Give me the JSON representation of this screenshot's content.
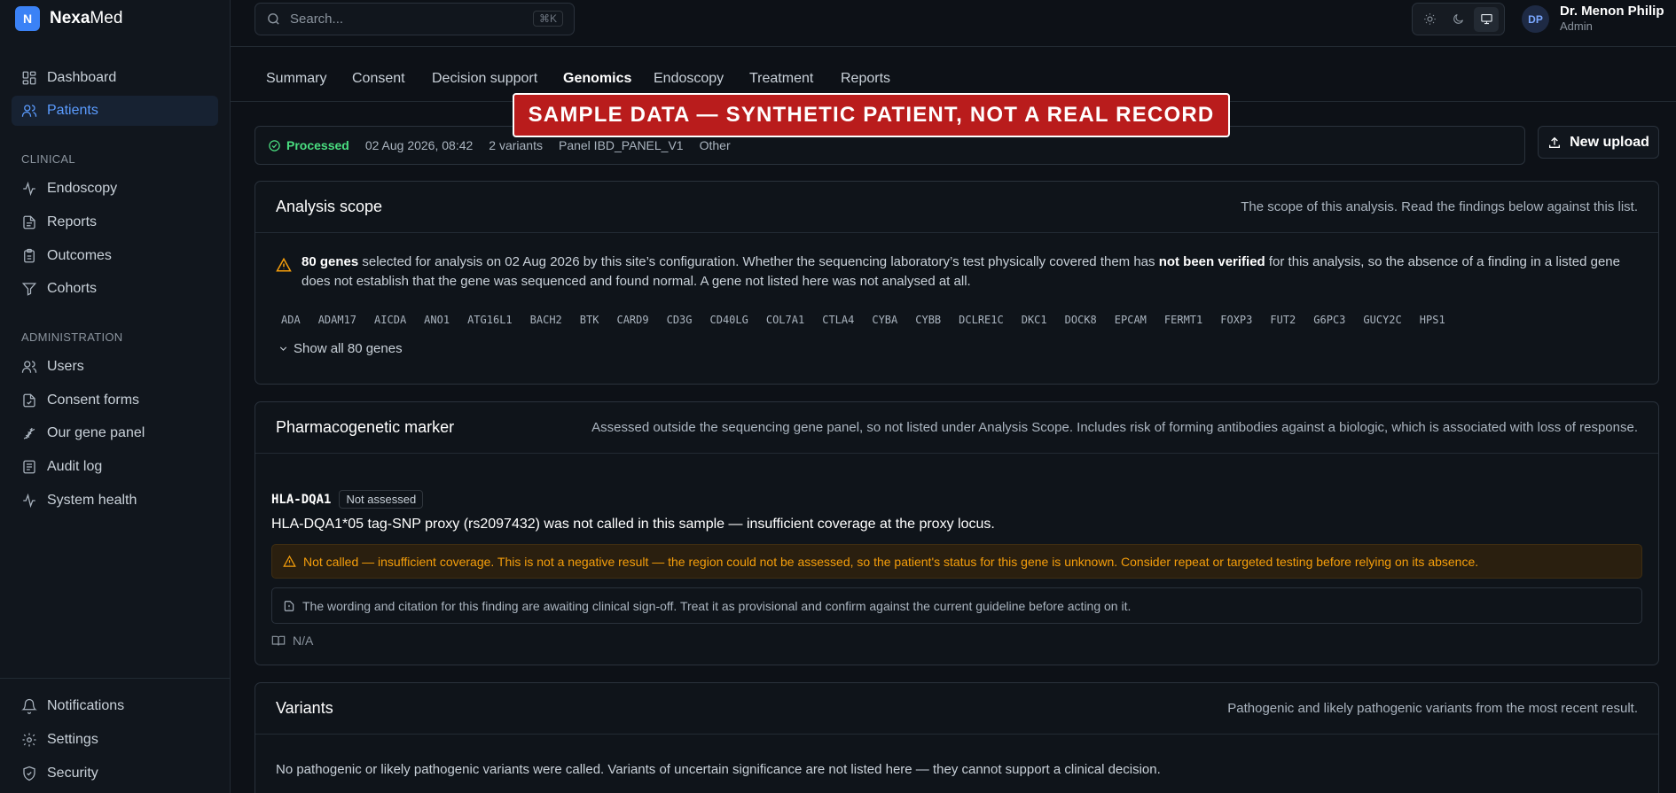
{
  "brand": {
    "logo_letter": "N",
    "name_bold": "Nexa",
    "name_rest": "Med"
  },
  "sidebar": {
    "top_items": [
      {
        "label": "Dashboard",
        "icon": "dashboard-icon"
      },
      {
        "label": "Patients",
        "icon": "users-icon",
        "active": true
      }
    ],
    "clinical_label": "CLINICAL",
    "clinical_items": [
      {
        "label": "Endoscopy",
        "icon": "activity-icon"
      },
      {
        "label": "Reports",
        "icon": "file-icon"
      },
      {
        "label": "Outcomes",
        "icon": "clipboard-icon"
      },
      {
        "label": "Cohorts",
        "icon": "filter-icon"
      }
    ],
    "admin_label": "ADMINISTRATION",
    "admin_items": [
      {
        "label": "Users",
        "icon": "users-icon"
      },
      {
        "label": "Consent forms",
        "icon": "file-check-icon"
      },
      {
        "label": "Our gene panel",
        "icon": "dna-icon"
      },
      {
        "label": "Audit log",
        "icon": "log-icon"
      },
      {
        "label": "System health",
        "icon": "activity-icon"
      }
    ],
    "bottom_items": [
      {
        "label": "Notifications",
        "icon": "bell-icon"
      },
      {
        "label": "Settings",
        "icon": "gear-icon"
      },
      {
        "label": "Security",
        "icon": "shield-icon"
      }
    ]
  },
  "search": {
    "placeholder": "Search...",
    "shortcut": "⌘K"
  },
  "user": {
    "initials": "DP",
    "name": "Dr. Menon Philip",
    "role": "Admin"
  },
  "tabs": [
    "Summary",
    "Consent",
    "Decision support",
    "Genomics",
    "Endoscopy",
    "Treatment",
    "Reports"
  ],
  "active_tab": "Genomics",
  "banner": "SAMPLE DATA — SYNTHETIC PATIENT, NOT A REAL RECORD",
  "status": {
    "state": "Processed",
    "datetime": "02 Aug 2026, 08:42",
    "variants": "2 variants",
    "panel": "Panel IBD_PANEL_V1",
    "type": "Other"
  },
  "upload_label": "New upload",
  "scope": {
    "title": "Analysis scope",
    "subtitle": "The scope of this analysis. Read the findings below against this list.",
    "count": "80 genes",
    "text_1": " selected for analysis on 02 Aug 2026 by this site’s configuration. Whether the sequencing laboratory’s test physically covered them has ",
    "emph": "not been verified",
    "text_2": " for this analysis, so the absence of a finding in a listed gene does not establish that the gene was sequenced and found normal. A gene not listed here was not analysed at all.",
    "genes": [
      "ADA",
      "ADAM17",
      "AICDA",
      "ANO1",
      "ATG16L1",
      "BACH2",
      "BTK",
      "CARD9",
      "CD3G",
      "CD40LG",
      "COL7A1",
      "CTLA4",
      "CYBA",
      "CYBB",
      "DCLRE1C",
      "DKC1",
      "DOCK8",
      "EPCAM",
      "FERMT1",
      "FOXP3",
      "FUT2",
      "G6PC3",
      "GUCY2C",
      "HPS1"
    ],
    "show_all": "Show all 80 genes"
  },
  "pharmaco": {
    "title": "Pharmacogenetic marker",
    "subtitle": "Assessed outside the sequencing gene panel, so not listed under Analysis Scope. Includes risk of forming antibodies against a biologic, which is associated with loss of response.",
    "marker": "HLA-DQA1",
    "badge": "Not assessed",
    "description": "HLA-DQA1*05 tag-SNP proxy (rs2097432) was not called in this sample — insufficient coverage at the proxy locus.",
    "warning": "Not called — insufficient coverage. This is not a negative result — the region could not be assessed, so the patient's status for this gene is unknown. Consider repeat or targeted testing before relying on its absence.",
    "note": "The wording and citation for this finding are awaiting clinical sign-off. Treat it as provisional and confirm against the current guideline before acting on it.",
    "citation": "N/A"
  },
  "variants": {
    "title": "Variants",
    "subtitle": "Pathogenic and likely pathogenic variants from the most recent result.",
    "empty_text": "No pathogenic or likely pathogenic variants were called. Variants of uncertain significance are not listed here — they cannot support a clinical decision."
  },
  "colors": {
    "accent": "#3b82f6",
    "success": "#4ade80",
    "warning": "#f59e0b",
    "banner": "#b91c1c"
  }
}
